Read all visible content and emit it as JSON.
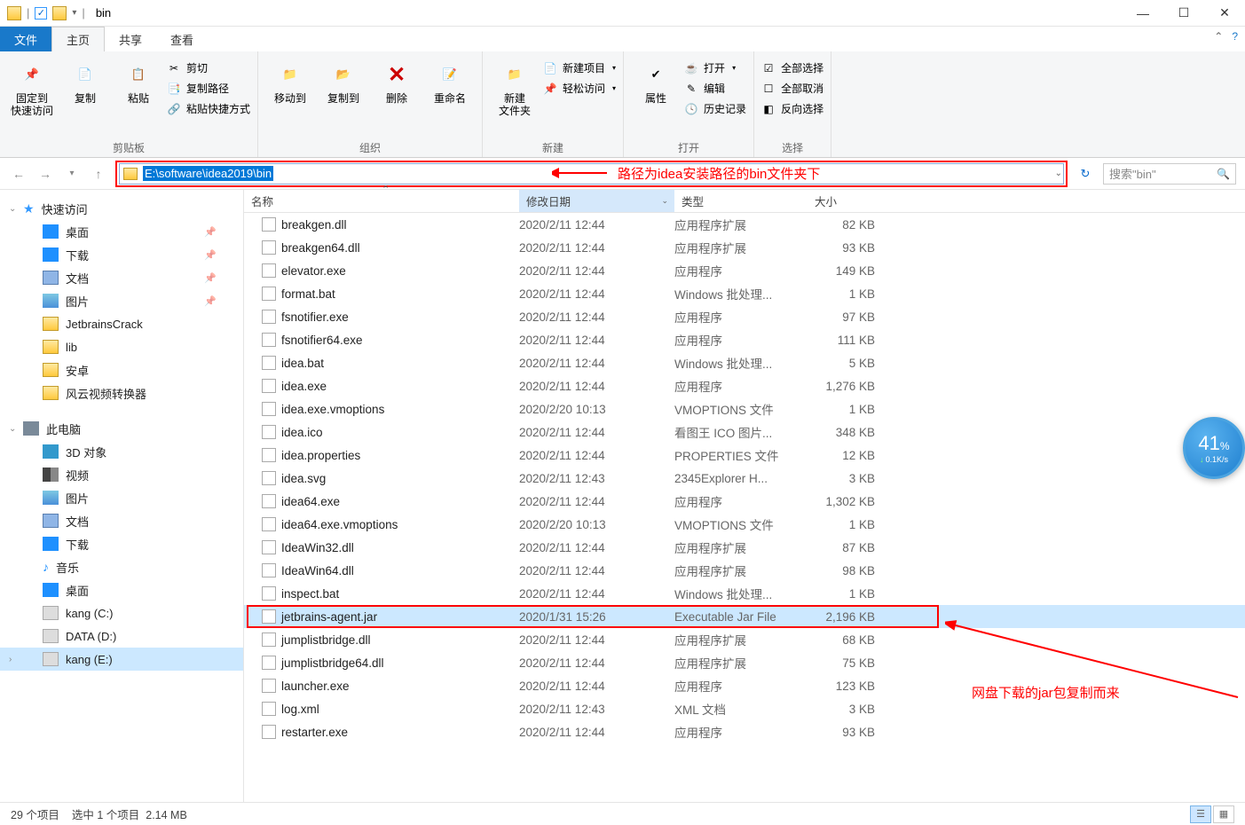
{
  "window": {
    "title": "bin"
  },
  "tabs": {
    "file": "文件",
    "home": "主页",
    "share": "共享",
    "view": "查看"
  },
  "ribbon": {
    "clipboard": {
      "pin": "固定到\n快速访问",
      "copy": "复制",
      "paste": "粘贴",
      "cut": "剪切",
      "copypath": "复制路径",
      "pastelink": "粘贴快捷方式",
      "label": "剪贴板"
    },
    "organize": {
      "moveto": "移动到",
      "copyto": "复制到",
      "delete": "删除",
      "rename": "重命名",
      "label": "组织"
    },
    "new": {
      "newfolder": "新建\n文件夹",
      "newitem": "新建项目",
      "easyaccess": "轻松访问",
      "label": "新建"
    },
    "open": {
      "props": "属性",
      "open": "打开",
      "edit": "编辑",
      "history": "历史记录",
      "label": "打开"
    },
    "select": {
      "all": "全部选择",
      "none": "全部取消",
      "invert": "反向选择",
      "label": "选择"
    }
  },
  "address": {
    "path": "E:\\software\\idea2019\\bin"
  },
  "annot_path": "路径为idea安装路径的bin文件夹下",
  "search": {
    "placeholder": "搜索\"bin\""
  },
  "columns": {
    "name": "名称",
    "date": "修改日期",
    "type": "类型",
    "size": "大小"
  },
  "sidebar": {
    "quick": "快速访问",
    "desktop": "桌面",
    "downloads": "下载",
    "documents": "文档",
    "pictures": "图片",
    "jetbrains": "JetbrainsCrack",
    "lib": "lib",
    "anzhuo": "安卓",
    "fengyun": "风云视频转换器",
    "thispc": "此电脑",
    "objects3d": "3D 对象",
    "videos": "视频",
    "pictures2": "图片",
    "documents2": "文档",
    "downloads2": "下载",
    "music": "音乐",
    "desktop2": "桌面",
    "drivec": "kang (C:)",
    "drived": "DATA (D:)",
    "drivee": "kang (E:)"
  },
  "files": [
    {
      "name": "breakgen.dll",
      "date": "2020/2/11 12:44",
      "type": "应用程序扩展",
      "size": "82 KB"
    },
    {
      "name": "breakgen64.dll",
      "date": "2020/2/11 12:44",
      "type": "应用程序扩展",
      "size": "93 KB"
    },
    {
      "name": "elevator.exe",
      "date": "2020/2/11 12:44",
      "type": "应用程序",
      "size": "149 KB"
    },
    {
      "name": "format.bat",
      "date": "2020/2/11 12:44",
      "type": "Windows 批处理...",
      "size": "1 KB"
    },
    {
      "name": "fsnotifier.exe",
      "date": "2020/2/11 12:44",
      "type": "应用程序",
      "size": "97 KB"
    },
    {
      "name": "fsnotifier64.exe",
      "date": "2020/2/11 12:44",
      "type": "应用程序",
      "size": "111 KB"
    },
    {
      "name": "idea.bat",
      "date": "2020/2/11 12:44",
      "type": "Windows 批处理...",
      "size": "5 KB"
    },
    {
      "name": "idea.exe",
      "date": "2020/2/11 12:44",
      "type": "应用程序",
      "size": "1,276 KB"
    },
    {
      "name": "idea.exe.vmoptions",
      "date": "2020/2/20 10:13",
      "type": "VMOPTIONS 文件",
      "size": "1 KB"
    },
    {
      "name": "idea.ico",
      "date": "2020/2/11 12:44",
      "type": "看图王 ICO 图片...",
      "size": "348 KB"
    },
    {
      "name": "idea.properties",
      "date": "2020/2/11 12:44",
      "type": "PROPERTIES 文件",
      "size": "12 KB"
    },
    {
      "name": "idea.svg",
      "date": "2020/2/11 12:43",
      "type": "2345Explorer H...",
      "size": "3 KB"
    },
    {
      "name": "idea64.exe",
      "date": "2020/2/11 12:44",
      "type": "应用程序",
      "size": "1,302 KB"
    },
    {
      "name": "idea64.exe.vmoptions",
      "date": "2020/2/20 10:13",
      "type": "VMOPTIONS 文件",
      "size": "1 KB"
    },
    {
      "name": "IdeaWin32.dll",
      "date": "2020/2/11 12:44",
      "type": "应用程序扩展",
      "size": "87 KB"
    },
    {
      "name": "IdeaWin64.dll",
      "date": "2020/2/11 12:44",
      "type": "应用程序扩展",
      "size": "98 KB"
    },
    {
      "name": "inspect.bat",
      "date": "2020/2/11 12:44",
      "type": "Windows 批处理...",
      "size": "1 KB"
    },
    {
      "name": "jetbrains-agent.jar",
      "date": "2020/1/31 15:26",
      "type": "Executable Jar File",
      "size": "2,196 KB",
      "selected": true
    },
    {
      "name": "jumplistbridge.dll",
      "date": "2020/2/11 12:44",
      "type": "应用程序扩展",
      "size": "68 KB"
    },
    {
      "name": "jumplistbridge64.dll",
      "date": "2020/2/11 12:44",
      "type": "应用程序扩展",
      "size": "75 KB"
    },
    {
      "name": "launcher.exe",
      "date": "2020/2/11 12:44",
      "type": "应用程序",
      "size": "123 KB"
    },
    {
      "name": "log.xml",
      "date": "2020/2/11 12:43",
      "type": "XML 文档",
      "size": "3 KB"
    },
    {
      "name": "restarter.exe",
      "date": "2020/2/11 12:44",
      "type": "应用程序",
      "size": "93 KB"
    }
  ],
  "annot_file": "网盘下载的jar包复制而来",
  "status": {
    "count": "29 个项目",
    "sel": "选中 1 个项目",
    "size": "2.14 MB"
  },
  "widget": {
    "pct": "41",
    "unit": "%",
    "speed": "0.1K/s"
  }
}
